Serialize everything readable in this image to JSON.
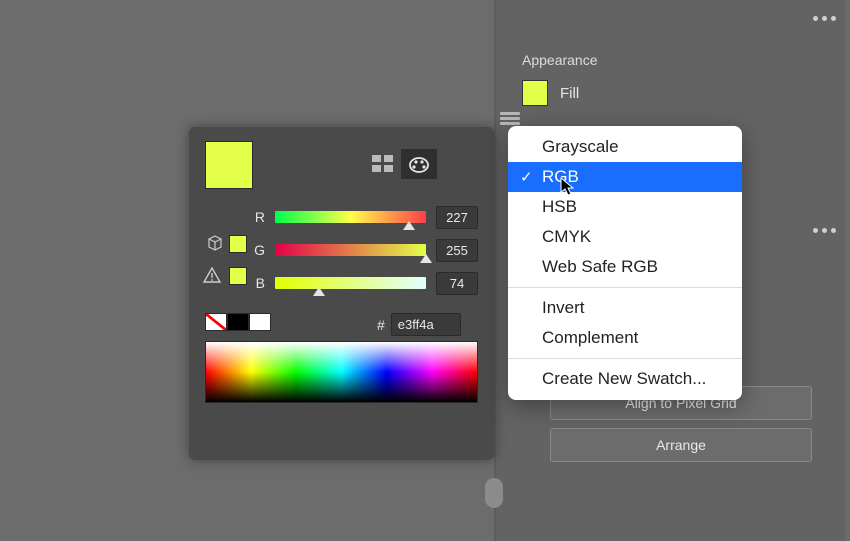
{
  "appearance": {
    "title": "Appearance",
    "fill_label": "Fill",
    "swatch_color": "#e3ff4a"
  },
  "buttons": {
    "align": "Align to Pixel Grid",
    "arrange": "Arrange"
  },
  "picker": {
    "r_label": "R",
    "g_label": "G",
    "b_label": "B",
    "r_value": "227",
    "g_value": "255",
    "b_value": "74",
    "r_pct": 89,
    "g_pct": 100,
    "b_pct": 29,
    "hex_hash": "#",
    "hex_value": "e3ff4a"
  },
  "menu": {
    "items": [
      {
        "label": "Grayscale",
        "selected": false
      },
      {
        "label": "RGB",
        "selected": true
      },
      {
        "label": "HSB",
        "selected": false
      },
      {
        "label": "CMYK",
        "selected": false
      },
      {
        "label": "Web Safe RGB",
        "selected": false
      }
    ],
    "group2": [
      {
        "label": "Invert"
      },
      {
        "label": "Complement"
      }
    ],
    "group3": [
      {
        "label": "Create New Swatch..."
      }
    ]
  }
}
